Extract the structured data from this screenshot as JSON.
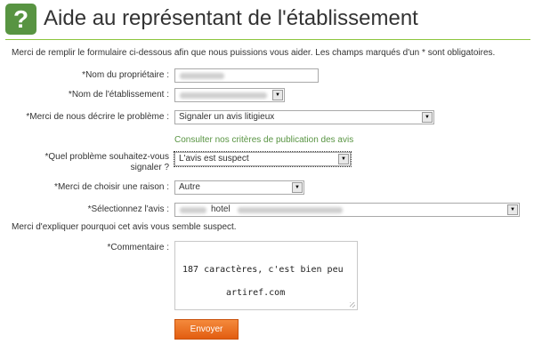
{
  "header": {
    "logo_glyph": "?",
    "title": "Aide au représentant de l'établissement"
  },
  "intro": "Merci de remplir le formulaire ci-dessous afin que nous puissions vous aider. Les champs marqués d'un * sont obligatoires.",
  "form": {
    "owner_label": "*Nom du propriétaire :",
    "establishment_label": "*Nom de l'établissement :",
    "problem_label": "*Merci de nous décrire le problème :",
    "problem_value": "Signaler un avis litigieux",
    "criteria_link": "Consulter nos critères de publication des avis",
    "report_label_line1": "*Quel problème souhaitez-vous",
    "report_label_line2": "signaler ?",
    "report_value": "L'avis est suspect",
    "reason_label": "*Merci de choisir une raison :",
    "reason_value": "Autre",
    "review_label": "*Sélectionnez l'avis :",
    "review_value_visible": "hotel",
    "explain": "Merci d'expliquer pourquoi cet avis vous semble suspect.",
    "comment_label": "*Commentaire :",
    "comment_line1": "187 caractères, c'est bien peu",
    "comment_line2": "artiref.com",
    "submit_label": "Envoyer"
  },
  "icons": {
    "arrow": "▼",
    "logo": "question-mark-icon"
  },
  "colors": {
    "brand_green": "#589442",
    "rule_green": "#8cc63e",
    "button_orange": "#e8661a"
  }
}
